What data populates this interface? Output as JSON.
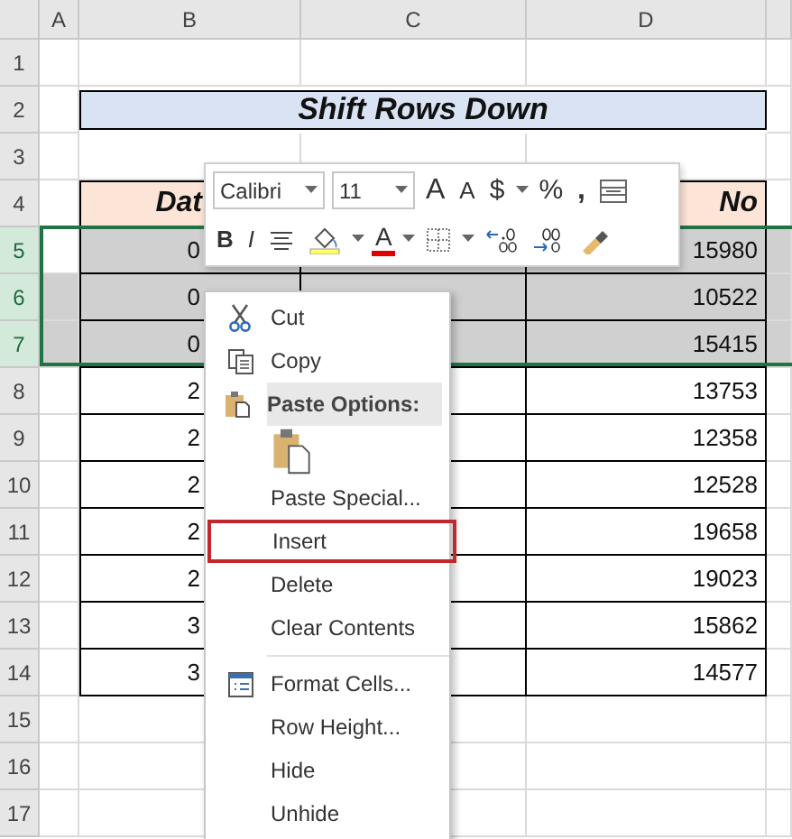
{
  "sheet": {
    "columns": [
      "A",
      "B",
      "C",
      "D"
    ],
    "rows": [
      {
        "number": "1",
        "selected": false,
        "kind": "blank"
      },
      {
        "number": "2",
        "selected": false,
        "kind": "title",
        "text": "Shift Rows Down"
      },
      {
        "number": "3",
        "selected": false,
        "kind": "blank"
      },
      {
        "number": "4",
        "selected": false,
        "kind": "header",
        "b": "Dat",
        "d": "No"
      },
      {
        "number": "5",
        "selected": true,
        "active": true,
        "kind": "data",
        "b": "0",
        "d": "15980"
      },
      {
        "number": "6",
        "selected": true,
        "kind": "data",
        "b": "0",
        "d": "10522"
      },
      {
        "number": "7",
        "selected": true,
        "kind": "data",
        "b": "0",
        "d": "15415"
      },
      {
        "number": "8",
        "selected": false,
        "kind": "data",
        "b": "2",
        "d": "13753"
      },
      {
        "number": "9",
        "selected": false,
        "kind": "data",
        "b": "2",
        "d": "12358"
      },
      {
        "number": "10",
        "selected": false,
        "kind": "data",
        "b": "2",
        "d": "12528"
      },
      {
        "number": "11",
        "selected": false,
        "kind": "data",
        "b": "2",
        "d": "19658"
      },
      {
        "number": "12",
        "selected": false,
        "kind": "data",
        "b": "2",
        "d": "19023"
      },
      {
        "number": "13",
        "selected": false,
        "kind": "data",
        "b": "3",
        "d": "15862"
      },
      {
        "number": "14",
        "selected": false,
        "kind": "data",
        "b": "3",
        "d": "14577"
      },
      {
        "number": "15",
        "selected": false,
        "kind": "blank"
      },
      {
        "number": "16",
        "selected": false,
        "kind": "blank"
      },
      {
        "number": "17",
        "selected": false,
        "kind": "blank"
      }
    ]
  },
  "mini_toolbar": {
    "font": "Calibri",
    "size": "11",
    "row_1": [
      {
        "kind": "grow",
        "label": "A"
      },
      {
        "kind": "shrink",
        "label": "A"
      },
      {
        "kind": "currency",
        "label": "$"
      },
      {
        "kind": "percent",
        "label": "%"
      },
      {
        "kind": "comma",
        "label": ","
      },
      {
        "kind": "format"
      }
    ],
    "row_2": [
      {
        "kind": "bold",
        "label": "B"
      },
      {
        "kind": "italic",
        "label": "I"
      },
      {
        "kind": "align"
      },
      {
        "kind": "fill"
      },
      {
        "kind": "font-color",
        "label": "A"
      },
      {
        "kind": "borders"
      },
      {
        "kind": "increase-decimal"
      },
      {
        "kind": "decrease-decimal"
      },
      {
        "kind": "painter"
      }
    ]
  },
  "context_menu": [
    {
      "kind": "cut",
      "label": "Cut",
      "highlighted": false
    },
    {
      "kind": "copy",
      "label": "Copy",
      "highlighted": false
    },
    {
      "kind": "header",
      "label": "Paste Options:"
    },
    {
      "kind": "paste"
    },
    {
      "kind": "item",
      "label": "Paste Special...",
      "highlighted": false
    },
    {
      "kind": "item",
      "label": "Insert",
      "highlighted": true
    },
    {
      "kind": "item",
      "label": "Delete",
      "highlighted": false
    },
    {
      "kind": "item",
      "label": "Clear Contents",
      "highlighted": false
    },
    {
      "kind": "separator"
    },
    {
      "kind": "format",
      "label": "Format Cells...",
      "highlighted": false
    },
    {
      "kind": "item",
      "label": "Row Height...",
      "highlighted": false
    },
    {
      "kind": "item",
      "label": "Hide",
      "highlighted": false
    },
    {
      "kind": "item",
      "label": "Unhide",
      "highlighted": false
    }
  ]
}
